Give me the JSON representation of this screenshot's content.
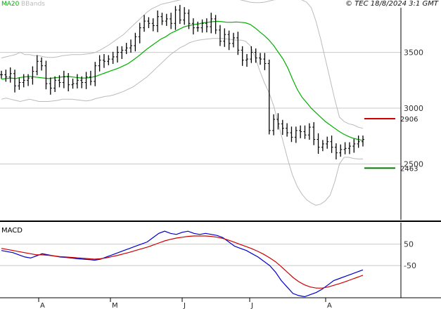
{
  "header": {
    "legend_ma": "MA20",
    "legend_bb": "BBands",
    "copyright": "© TEC 18/8/2024 3:1 GMT"
  },
  "colors": {
    "ma": "#00b000",
    "bbands": "#bbbbbb",
    "bars": "#000000",
    "resistance": "#cc0000",
    "support": "#008000",
    "macd": "#0000cc",
    "signal": "#cc0000",
    "grid": "#c8c8c8"
  },
  "chart_data": [
    {
      "type": "ohlc",
      "title": "",
      "y_ticks": [
        "3500",
        "3000",
        "2500"
      ],
      "ylim": [
        2000,
        3900
      ],
      "grid": true,
      "levels": [
        {
          "label": "2906",
          "value": 2906,
          "color": "resistance"
        },
        {
          "label": "2463",
          "value": 2463,
          "color": "support"
        }
      ],
      "series": [
        {
          "name": "MA20",
          "values": [
            3260,
            3265,
            3270,
            3265,
            3275,
            3280,
            3285,
            3280,
            3275,
            3270,
            3265,
            3270,
            3275,
            3280,
            3285,
            3280,
            3275,
            3270,
            3270,
            3275,
            3285,
            3300,
            3315,
            3330,
            3345,
            3360,
            3380,
            3400,
            3430,
            3460,
            3495,
            3530,
            3560,
            3590,
            3620,
            3640,
            3670,
            3690,
            3710,
            3730,
            3740,
            3750,
            3755,
            3765,
            3770,
            3775,
            3778,
            3775,
            3770,
            3770,
            3772,
            3770,
            3765,
            3750,
            3720,
            3685,
            3650,
            3610,
            3560,
            3500,
            3440,
            3360,
            3260,
            3170,
            3100,
            3050,
            3000,
            2960,
            2920,
            2880,
            2850,
            2820,
            2790,
            2765,
            2745,
            2730,
            2720,
            2710
          ]
        },
        {
          "name": "BBands-upper",
          "values": [
            3450,
            3460,
            3470,
            3480,
            3500,
            3480,
            3480,
            3470,
            3470,
            3460,
            3455,
            3455,
            3460,
            3470,
            3475,
            3480,
            3480,
            3480,
            3485,
            3490,
            3500,
            3520,
            3545,
            3570,
            3600,
            3630,
            3660,
            3700,
            3740,
            3780,
            3820,
            3860,
            3890,
            3910,
            3930,
            3940,
            3950,
            3960,
            3970,
            3975,
            3980,
            3980,
            3985,
            3990,
            3990,
            3990,
            3990,
            3990,
            3990,
            3985,
            3980,
            3970,
            3960,
            3950,
            3945,
            3945,
            3950,
            3960,
            3970,
            3975,
            3980,
            3990,
            3990,
            3980,
            3970,
            3950,
            3900,
            3780,
            3620,
            3440,
            3260,
            3080,
            2920,
            2880,
            2860,
            2850,
            2830,
            2820
          ]
        },
        {
          "name": "BBands-lower",
          "values": [
            3080,
            3090,
            3080,
            3070,
            3060,
            3070,
            3080,
            3070,
            3060,
            3060,
            3060,
            3065,
            3070,
            3080,
            3080,
            3080,
            3075,
            3070,
            3065,
            3070,
            3085,
            3095,
            3105,
            3110,
            3120,
            3135,
            3150,
            3170,
            3190,
            3220,
            3250,
            3280,
            3320,
            3360,
            3400,
            3440,
            3480,
            3510,
            3540,
            3560,
            3585,
            3600,
            3610,
            3615,
            3620,
            3625,
            3625,
            3625,
            3620,
            3615,
            3610,
            3610,
            3600,
            3560,
            3460,
            3340,
            3230,
            3140,
            3020,
            2860,
            2700,
            2540,
            2400,
            2300,
            2230,
            2180,
            2150,
            2130,
            2140,
            2170,
            2220,
            2340,
            2500,
            2560,
            2560,
            2550,
            2545,
            2545
          ]
        },
        {
          "name": "Price-close",
          "values": [
            3300,
            3280,
            3310,
            3200,
            3230,
            3250,
            3270,
            3330,
            3420,
            3380,
            3220,
            3180,
            3250,
            3230,
            3280,
            3210,
            3220,
            3250,
            3230,
            3280,
            3240,
            3380,
            3430,
            3420,
            3440,
            3460,
            3500,
            3520,
            3540,
            3560,
            3640,
            3720,
            3780,
            3760,
            3740,
            3820,
            3780,
            3800,
            3760,
            3880,
            3790,
            3850,
            3760,
            3720,
            3720,
            3760,
            3730,
            3800,
            3700,
            3600,
            3660,
            3580,
            3630,
            3520,
            3430,
            3440,
            3500,
            3450,
            3440,
            3400,
            2800,
            2900,
            2860,
            2820,
            2780,
            2740,
            2800,
            2790,
            2760,
            2830,
            2720,
            2650,
            2680,
            2700,
            2650,
            2600,
            2630,
            2640,
            2660,
            2680,
            2700,
            2720
          ]
        }
      ]
    },
    {
      "type": "line",
      "title": "MACD",
      "y_ticks": [
        "50",
        "-50"
      ],
      "ylim": [
        -200,
        150
      ],
      "series": [
        {
          "name": "MACD",
          "values": [
            20,
            15,
            10,
            0,
            -10,
            -15,
            -5,
            5,
            0,
            -5,
            -10,
            -12,
            -15,
            -18,
            -20,
            -22,
            -25,
            -20,
            -10,
            0,
            10,
            20,
            30,
            40,
            50,
            60,
            80,
            100,
            110,
            100,
            95,
            105,
            110,
            100,
            95,
            100,
            95,
            90,
            80,
            60,
            40,
            30,
            20,
            5,
            -10,
            -30,
            -50,
            -80,
            -120,
            -150,
            -180,
            -190,
            -195,
            -185,
            -175,
            -160,
            -140,
            -120,
            -110,
            -100,
            -90,
            -80,
            -70
          ]
        },
        {
          "name": "Signal",
          "values": [
            30,
            25,
            20,
            15,
            10,
            5,
            0,
            0,
            -2,
            -5,
            -8,
            -10,
            -12,
            -14,
            -16,
            -18,
            -20,
            -18,
            -14,
            -8,
            -2,
            5,
            12,
            20,
            28,
            36,
            45,
            55,
            65,
            72,
            78,
            82,
            86,
            88,
            88,
            88,
            86,
            82,
            76,
            68,
            58,
            48,
            38,
            28,
            16,
            2,
            -14,
            -32,
            -55,
            -80,
            -105,
            -125,
            -140,
            -150,
            -155,
            -155,
            -150,
            -142,
            -134,
            -125,
            -115,
            -105,
            -95
          ]
        }
      ]
    }
  ],
  "x_axis": {
    "ticks": [
      {
        "label": "A"
      },
      {
        "label": "M"
      },
      {
        "label": "J"
      },
      {
        "label": "J"
      },
      {
        "label": "A"
      }
    ]
  }
}
